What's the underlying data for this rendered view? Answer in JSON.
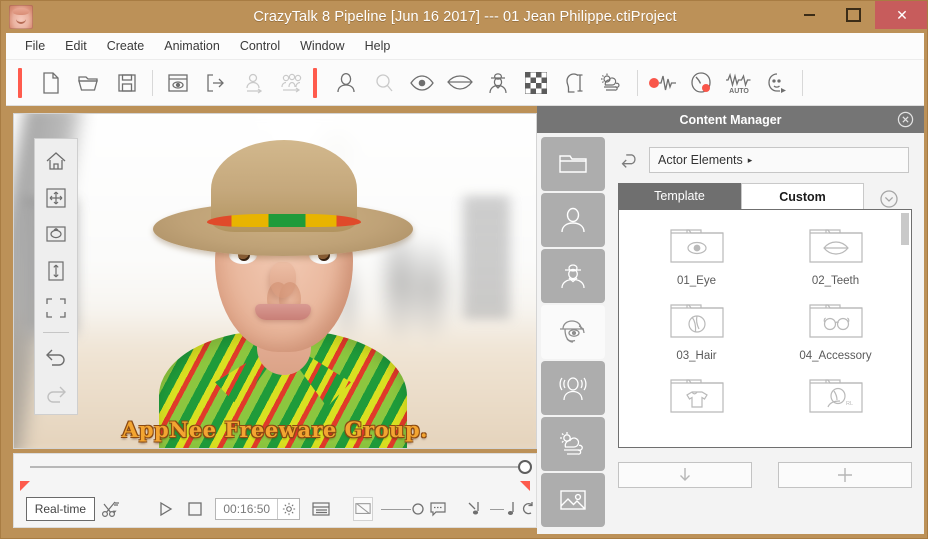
{
  "window": {
    "title": "CrazyTalk 8 Pipeline [Jun 16 2017] --- 01 Jean Philippe.ctiProject",
    "app_icon": "face-icon",
    "minimize": "–",
    "maximize": "□",
    "close": "✕",
    "titlebar_color": "#bc9158",
    "close_color": "#c75c5c"
  },
  "menubar": {
    "items": [
      {
        "label": "File"
      },
      {
        "label": "Edit"
      },
      {
        "label": "Create"
      },
      {
        "label": "Animation"
      },
      {
        "label": "Control"
      },
      {
        "label": "Window"
      },
      {
        "label": "Help"
      }
    ]
  },
  "toolbar": {
    "accent_color": "#ff5b4d",
    "groups": [
      {
        "marker": true,
        "items": [
          {
            "icon": "new-document-icon",
            "enabled": true
          },
          {
            "icon": "open-folder-icon",
            "enabled": true
          },
          {
            "icon": "save-floppy-icon",
            "enabled": true
          }
        ]
      },
      {
        "marker": false,
        "items": [
          {
            "icon": "preview-window-icon",
            "enabled": true
          },
          {
            "icon": "export-icon",
            "enabled": true
          },
          {
            "icon": "export-actor-icon",
            "enabled": false
          },
          {
            "icon": "export-group-icon",
            "enabled": false
          }
        ]
      },
      {
        "marker": true,
        "items": [
          {
            "icon": "head-actor-icon",
            "enabled": true
          },
          {
            "icon": "face-fitting-icon",
            "enabled": false
          },
          {
            "icon": "eye-icon",
            "enabled": true
          },
          {
            "icon": "mouth-icon",
            "enabled": true
          },
          {
            "icon": "avatar-body-icon",
            "enabled": true
          },
          {
            "icon": "checkerboard-icon",
            "enabled": true
          },
          {
            "icon": "head-measure-icon",
            "enabled": true
          },
          {
            "icon": "weather-wind-icon",
            "enabled": true
          }
        ]
      },
      {
        "marker": false,
        "items": [
          {
            "icon": "record-audio-wave-icon",
            "enabled": true
          },
          {
            "icon": "face-puppet-record-icon",
            "enabled": true
          },
          {
            "icon": "auto-motion-icon",
            "enabled": true
          },
          {
            "icon": "head-motion-icon",
            "enabled": true
          }
        ]
      }
    ]
  },
  "viewport": {
    "watermark": "AppNee Freeware Group.",
    "tools": [
      {
        "icon": "home-icon",
        "enabled": true
      },
      {
        "icon": "move-icon",
        "enabled": true
      },
      {
        "icon": "rotate-icon",
        "enabled": true
      },
      {
        "icon": "scale-vertical-icon",
        "enabled": true
      },
      {
        "icon": "fit-frame-icon",
        "enabled": true
      },
      {
        "icon": "undo-icon",
        "enabled": true
      },
      {
        "icon": "redo-icon",
        "enabled": false
      }
    ]
  },
  "timeline": {
    "playhead_position_percent": 100,
    "marker_color": "#fd5a4c",
    "mode_label": "Real-time",
    "timecode": "00:16:50",
    "controls": [
      {
        "icon": "scissors-dropdown-icon",
        "enabled": true
      },
      {
        "icon": "play-icon",
        "enabled": true
      },
      {
        "icon": "stop-icon",
        "enabled": true
      },
      {
        "icon": "timecode-gear-icon",
        "enabled": true
      },
      {
        "icon": "timeline-list-icon",
        "enabled": true
      },
      {
        "icon": "screen-mute-icon",
        "enabled": true
      },
      {
        "icon": "volume-slider-icon",
        "enabled": true
      },
      {
        "icon": "subtitle-icon",
        "enabled": true
      },
      {
        "icon": "note-mute-icon",
        "enabled": true
      },
      {
        "icon": "music-slider-icon",
        "enabled": true
      },
      {
        "icon": "loop-icon",
        "enabled": true
      }
    ]
  },
  "content_manager": {
    "title": "Content Manager",
    "close_icon": "close-circle-icon",
    "rail": [
      {
        "icon": "folder-icon",
        "active": false
      },
      {
        "icon": "head-silhouette-icon",
        "active": false
      },
      {
        "icon": "avatar-suit-icon",
        "active": false
      },
      {
        "icon": "actor-elements-icon",
        "active": true
      },
      {
        "icon": "head-motion-icon",
        "active": false
      },
      {
        "icon": "weather-scene-icon",
        "active": false
      },
      {
        "icon": "image-icon",
        "active": false
      }
    ],
    "back_icon": "back-arrow-icon",
    "path": "Actor Elements",
    "path_caret": "▸",
    "tabs": [
      {
        "label": "Template",
        "active": false
      },
      {
        "label": "Custom",
        "active": true
      }
    ],
    "expand_icon": "chevron-down-circle-icon",
    "items": [
      {
        "label": "01_Eye",
        "icon": "folder-eye-icon"
      },
      {
        "label": "02_Teeth",
        "icon": "folder-teeth-icon"
      },
      {
        "label": "03_Hair",
        "icon": "folder-hair-icon"
      },
      {
        "label": "04_Accessory",
        "icon": "folder-glasses-icon"
      },
      {
        "label": "",
        "icon": "folder-shirt-icon"
      },
      {
        "label": "",
        "icon": "folder-avatar-rl-icon"
      }
    ],
    "footer": [
      {
        "icon": "download-arrow-icon",
        "name": "apply-button"
      },
      {
        "icon": "plus-icon",
        "name": "add-button"
      }
    ]
  }
}
